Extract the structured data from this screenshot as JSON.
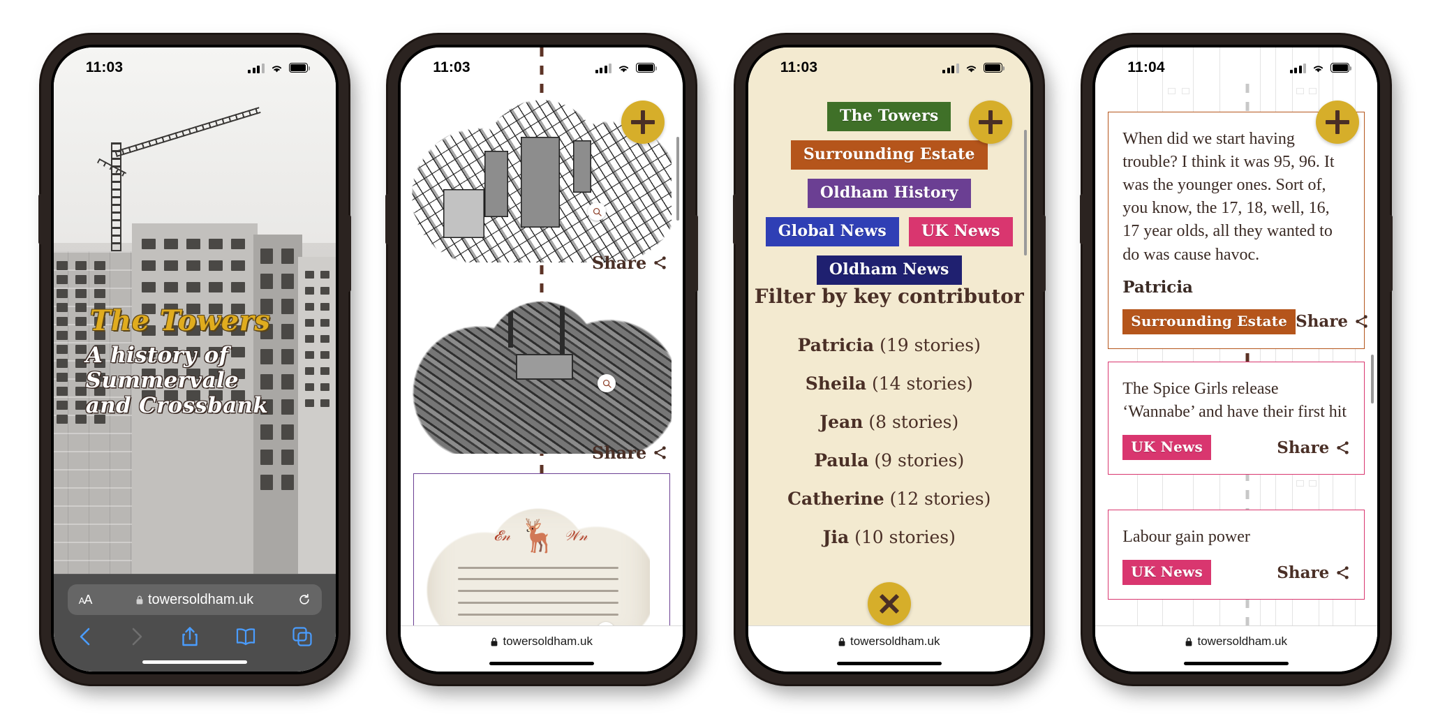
{
  "colors": {
    "gold": "#d6ae2a",
    "brown": "#4a2f26",
    "cream": "#f3ead0",
    "green": "#3f7028",
    "orange": "#b5551b",
    "purple": "#6b3f93",
    "blue": "#2f3fb5",
    "pink": "#d9366f",
    "navy": "#1f2070"
  },
  "browser": {
    "url": "towersoldham.uk",
    "lock_icon": "lock-icon",
    "text_size_label": "AA",
    "reload_icon": "reload-icon",
    "back_icon": "back-chevron-icon",
    "forward_icon": "forward-chevron-icon",
    "share_icon": "share-up-arrow-icon",
    "bookmarks_icon": "book-icon",
    "tabs_icon": "tabs-icon"
  },
  "phones": [
    {
      "id": "phone-1-home",
      "status": {
        "time": "11:03",
        "signal_icon": "cellular-bars-icon",
        "wifi_icon": "wifi-icon",
        "battery_icon": "battery-full-icon"
      },
      "hero": {
        "title": "The Towers",
        "subtitle": "A history of\nSummervale\nand Crossbank",
        "photo_alt": "black and white photo of tower blocks under construction with a crane"
      }
    },
    {
      "id": "phone-2-timeline",
      "status": {
        "time": "11:03",
        "signal_icon": "cellular-bars-icon",
        "wifi_icon": "wifi-icon",
        "battery_icon": "battery-full-icon"
      },
      "fab": {
        "icon": "plus-icon",
        "label": "Add"
      },
      "items": [
        {
          "kind": "cloud-map",
          "share_label": "Share",
          "share_icon": "share-icon",
          "zoom_icon": "magnifier-icon",
          "alt": "historic ordnance survey street map cloud"
        },
        {
          "kind": "cloud-aerial",
          "share_label": "Share",
          "share_icon": "share-icon",
          "zoom_icon": "magnifier-icon",
          "alt": "aerial photo of mills and terraced streets"
        },
        {
          "kind": "cloud-letter",
          "card_border": "purple",
          "zoom_icon": "magnifier-icon",
          "alt": "handwritten Christmas letter with stag illustration"
        }
      ]
    },
    {
      "id": "phone-3-filter",
      "status": {
        "time": "11:03",
        "signal_icon": "cellular-bars-icon",
        "wifi_icon": "wifi-icon",
        "battery_icon": "battery-full-icon"
      },
      "fab": {
        "icon": "plus-icon",
        "label": "Add"
      },
      "close_button": {
        "icon": "close-icon",
        "label": "Close"
      },
      "tags": [
        [
          {
            "label": "The Towers",
            "color": "#3f7028"
          }
        ],
        [
          {
            "label": "Surrounding Estate",
            "color": "#b5551b"
          }
        ],
        [
          {
            "label": "Oldham History",
            "color": "#6b3f93"
          }
        ],
        [
          {
            "label": "Global News",
            "color": "#2f3fb5"
          },
          {
            "label": "UK News",
            "color": "#d9366f"
          }
        ],
        [
          {
            "label": "Oldham News",
            "color": "#1f2070"
          }
        ]
      ],
      "filter_heading": "Filter by key contributor",
      "contributors": [
        {
          "name": "Patricia",
          "count": "(19 stories)"
        },
        {
          "name": "Sheila",
          "count": "(14 stories)"
        },
        {
          "name": "Jean",
          "count": "(8 stories)"
        },
        {
          "name": "Paula",
          "count": "(9 stories)"
        },
        {
          "name": "Catherine",
          "count": "(12 stories)"
        },
        {
          "name": "Jia",
          "count": "(10 stories)"
        }
      ]
    },
    {
      "id": "phone-4-stories",
      "status": {
        "time": "11:04",
        "signal_icon": "cellular-bars-icon",
        "wifi_icon": "wifi-icon",
        "battery_icon": "battery-full-icon"
      },
      "fab": {
        "icon": "plus-icon",
        "label": "Add"
      },
      "cards": [
        {
          "border": "orange",
          "quote": "When did we start having trouble? I think it was 95, 96. It was the younger ones. Sort of, you know, the 17, 18, well, 16, 17 year olds, all they wanted to do was cause havoc.",
          "author": "Patricia",
          "tag": {
            "label": "Surrounding Estate",
            "color": "#b5551b"
          },
          "share_label": "Share",
          "share_icon": "share-icon"
        },
        {
          "border": "pink",
          "quote": "The Spice Girls release ‘Wannabe’ and have their first hit",
          "author": "",
          "tag": {
            "label": "UK News",
            "color": "#d9366f"
          },
          "share_label": "Share",
          "share_icon": "share-icon"
        },
        {
          "border": "pink",
          "quote": "Labour gain power",
          "author": "",
          "tag": {
            "label": "UK News",
            "color": "#d9366f"
          },
          "share_label": "Share",
          "share_icon": "share-icon"
        }
      ]
    }
  ]
}
